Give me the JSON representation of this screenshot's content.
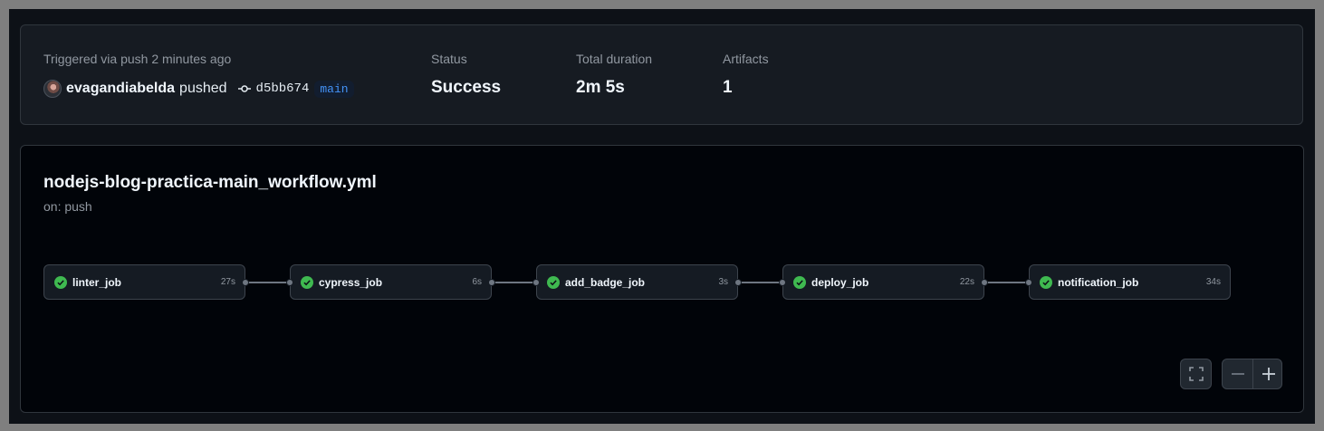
{
  "summary": {
    "trigger_text": "Triggered via push 2 minutes ago",
    "actor": "evagandiabelda",
    "action": "pushed",
    "commit_sha": "d5bb674",
    "branch": "main",
    "status_label": "Status",
    "status_value": "Success",
    "duration_label": "Total duration",
    "duration_value": "2m 5s",
    "artifacts_label": "Artifacts",
    "artifacts_value": "1"
  },
  "workflow": {
    "name": "nodejs-blog-practica-main_workflow.yml",
    "trigger": "on: push",
    "jobs": [
      {
        "name": "linter_job",
        "duration": "27s",
        "status": "success"
      },
      {
        "name": "cypress_job",
        "duration": "6s",
        "status": "success"
      },
      {
        "name": "add_badge_job",
        "duration": "3s",
        "status": "success"
      },
      {
        "name": "deploy_job",
        "duration": "22s",
        "status": "success"
      },
      {
        "name": "notification_job",
        "duration": "34s",
        "status": "success"
      }
    ]
  },
  "controls": {
    "fullscreen_icon": "fullscreen-icon",
    "zoom_out_icon": "minus-icon",
    "zoom_in_icon": "plus-icon"
  },
  "colors": {
    "success": "#3fb950",
    "branch_text": "#4493f8",
    "panel_bg": "#161b22",
    "graph_bg": "#010409"
  }
}
